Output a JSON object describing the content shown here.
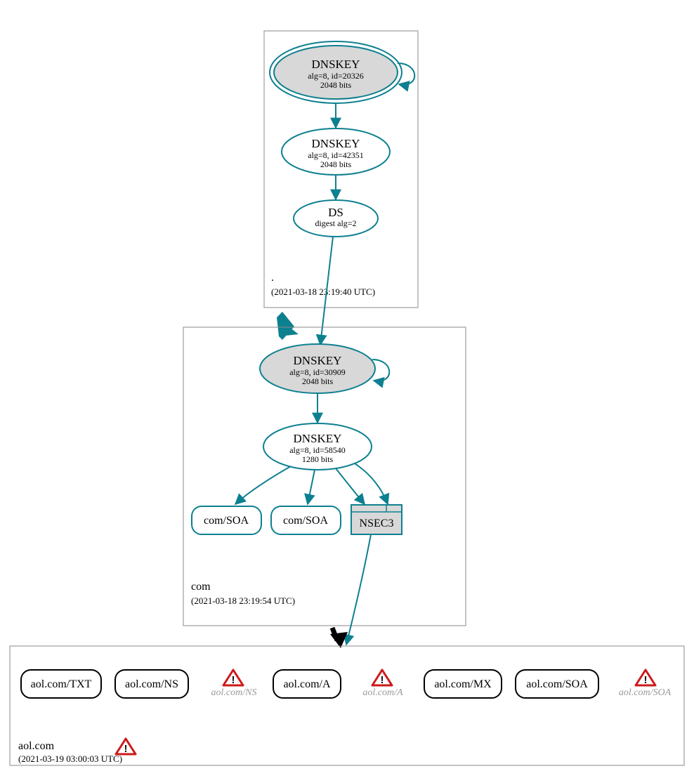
{
  "colors": {
    "teal": "#0d8090",
    "grey_fill": "#d8d8d8",
    "warn_red": "#cc1a1a",
    "warn_border": "#1a1a1a"
  },
  "zones": {
    "root": {
      "name": ".",
      "time": "(2021-03-18 23:19:40 UTC)"
    },
    "com": {
      "name": "com",
      "time": "(2021-03-18 23:19:54 UTC)"
    },
    "aol": {
      "name": "aol.com",
      "time": "(2021-03-19 03:00:03 UTC)"
    }
  },
  "nodes": {
    "root_ksk": {
      "title": "DNSKEY",
      "sub1": "alg=8, id=20326",
      "sub2": "2048 bits"
    },
    "root_zsk": {
      "title": "DNSKEY",
      "sub1": "alg=8, id=42351",
      "sub2": "2048 bits"
    },
    "root_ds": {
      "title": "DS",
      "sub1": "digest alg=2"
    },
    "com_ksk": {
      "title": "DNSKEY",
      "sub1": "alg=8, id=30909",
      "sub2": "2048 bits"
    },
    "com_zsk": {
      "title": "DNSKEY",
      "sub1": "alg=8, id=58540",
      "sub2": "1280 bits"
    },
    "com_soa1": {
      "label": "com/SOA"
    },
    "com_soa2": {
      "label": "com/SOA"
    },
    "nsec3": {
      "label": "NSEC3"
    },
    "aol_txt": {
      "label": "aol.com/TXT"
    },
    "aol_ns": {
      "label": "aol.com/NS"
    },
    "aol_ns_w": {
      "label": "aol.com/NS"
    },
    "aol_a": {
      "label": "aol.com/A"
    },
    "aol_a_w": {
      "label": "aol.com/A"
    },
    "aol_mx": {
      "label": "aol.com/MX"
    },
    "aol_soa": {
      "label": "aol.com/SOA"
    },
    "aol_soa_w": {
      "label": "aol.com/SOA"
    }
  }
}
